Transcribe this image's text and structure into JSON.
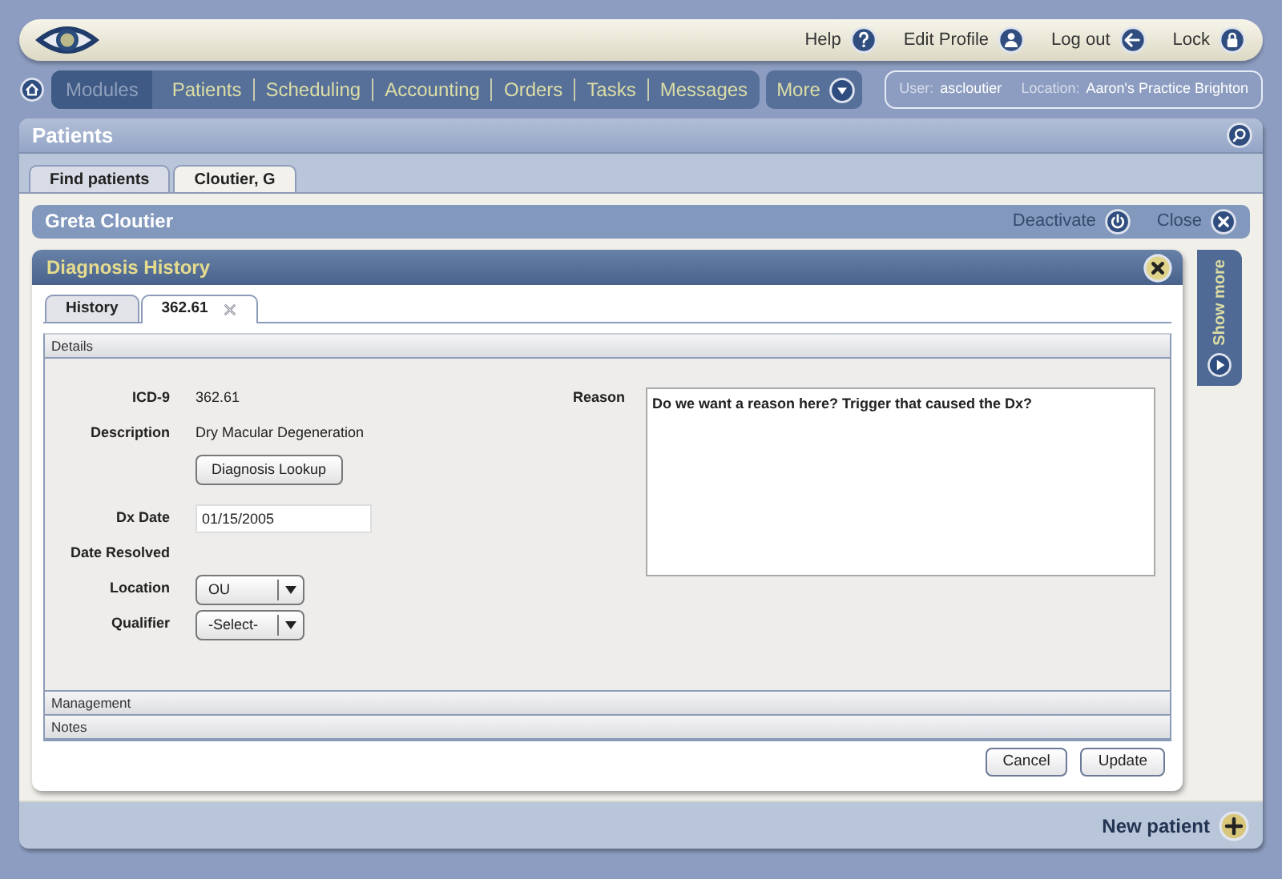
{
  "header": {
    "links": [
      {
        "label": "Help"
      },
      {
        "label": "Edit Profile"
      },
      {
        "label": "Log out"
      },
      {
        "label": "Lock"
      }
    ]
  },
  "nav": {
    "items": [
      {
        "label": "Modules",
        "selected": true
      },
      {
        "label": "Patients",
        "selected": false
      },
      {
        "label": "Scheduling",
        "selected": false
      },
      {
        "label": "Accounting",
        "selected": false
      },
      {
        "label": "Orders",
        "selected": false
      },
      {
        "label": "Tasks",
        "selected": false
      },
      {
        "label": "Messages",
        "selected": false
      }
    ],
    "more": "More"
  },
  "session": {
    "user_label": "User:",
    "user": "ascloutier",
    "location_label": "Location:",
    "location": "Aaron's Practice Brighton"
  },
  "panel": {
    "title": "Patients",
    "tabs": [
      {
        "label": "Find patients",
        "selected": false
      },
      {
        "label": "Cloutier, G",
        "selected": true
      }
    ],
    "patient": {
      "name": "Greta Cloutier",
      "actions": [
        {
          "label": "Deactivate"
        },
        {
          "label": "Close"
        }
      ]
    },
    "dialog": {
      "title": "Diagnosis History",
      "tabs": [
        {
          "label": "History",
          "selected": false,
          "closable": false
        },
        {
          "label": "362.61",
          "selected": true,
          "closable": true
        }
      ],
      "sections": [
        "Details",
        "Management",
        "Notes"
      ],
      "fields": [
        {
          "kind": "text",
          "label": "ICD-9",
          "value": "362.61"
        },
        {
          "kind": "text",
          "label": "Description",
          "value": "Dry Macular Degeneration"
        },
        {
          "kind": "button",
          "text": "Diagnosis Lookup"
        },
        {
          "kind": "input",
          "label": "Dx Date",
          "value": "01/15/2005"
        },
        {
          "kind": "text",
          "label": "Date Resolved"
        },
        {
          "kind": "select",
          "label": "Location",
          "value": "OU"
        },
        {
          "kind": "select",
          "label": "Qualifier",
          "value": "-Select-"
        }
      ],
      "reason": {
        "label": "Reason",
        "value": "Do we want a reason here? Trigger that caused the Dx?"
      },
      "buttons": [
        "Cancel",
        "Update"
      ]
    },
    "side_tab": "Show more",
    "footer_action": "New patient"
  }
}
